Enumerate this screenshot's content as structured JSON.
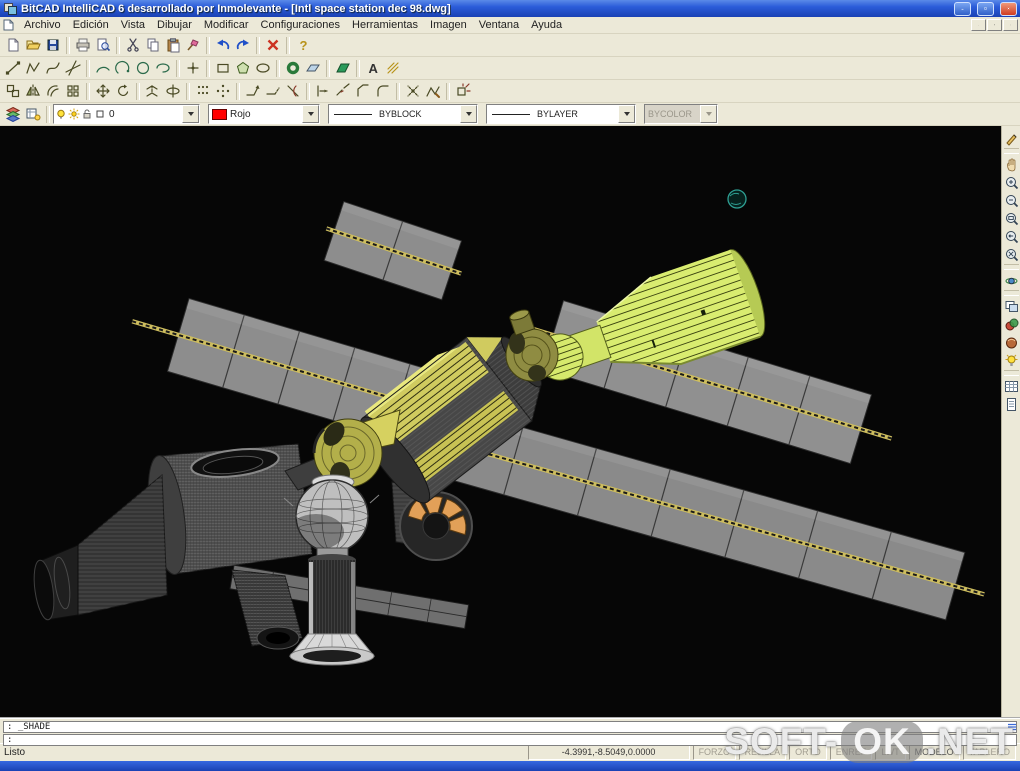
{
  "window": {
    "title": "BitCAD IntelliCAD 6 desarrollado por Inmolevante - [Intl space station dec 98.dwg]",
    "controls": [
      "minimize",
      "maximize",
      "close"
    ]
  },
  "menu": {
    "items": [
      "Archivo",
      "Edición",
      "Vista",
      "Dibujar",
      "Modificar",
      "Configuraciones",
      "Herramientas",
      "Imagen",
      "Ventana",
      "Ayuda"
    ],
    "child_controls": [
      "minimize",
      "restore",
      "close"
    ]
  },
  "toolbars": {
    "standard": [
      "new",
      "open",
      "save",
      "print",
      "print-preview",
      "cut",
      "copy",
      "paste",
      "match-properties",
      "undo",
      "redo",
      "delete",
      "help"
    ],
    "draw": [
      "line",
      "polyline",
      "spline",
      "construction-line",
      "arc",
      "arc-3pt",
      "circle",
      "ellipse-arc",
      "point",
      "rectangle",
      "polygon",
      "ellipse",
      "donut",
      "plane",
      "solid",
      "text",
      "hatch"
    ],
    "modify": [
      "copy",
      "mirror",
      "offset",
      "array",
      "move",
      "rotate",
      "mirror-3d",
      "rotate-3d",
      "array-rect",
      "array-polar",
      "stretch",
      "lengthen",
      "trim",
      "extend",
      "break",
      "chamfer",
      "fillet",
      "explode",
      "edit-polyline",
      "explode-block"
    ],
    "view_vertical": [
      "redraw",
      "pan",
      "zoom-in",
      "zoom-out",
      "zoom-window",
      "zoom-previous",
      "zoom-extents",
      "orbit",
      "named-views",
      "render",
      "materials",
      "lights",
      "table",
      "sheet"
    ],
    "format": {
      "layer_value": "0",
      "color_value": "Rojo",
      "linetype_value": "BYBLOCK",
      "lineweight_value": "BYLAYER",
      "plotstyle_value": "BYCOLOR"
    }
  },
  "icons": {
    "help_glyph": "?",
    "text_glyph": "A"
  },
  "command": {
    "lines": [
      ": _SHADE",
      ":"
    ]
  },
  "status": {
    "ready": "Listo",
    "coords": "-4.3991,-8.5049,0.0000",
    "toggles": [
      "FORZC",
      "REJILLA",
      "ORTO",
      "ENREF",
      "LWT",
      "MODELO",
      "TABLERO"
    ]
  },
  "watermark": {
    "soft": "SOFT-",
    "ok": "OK",
    "net": ".NET"
  },
  "colors": {
    "current_color": "#ff0000",
    "titlebar": "#2b5cd9",
    "viewport_bg": "#060606",
    "model_green": "#d9ec70",
    "solar_gray": "#8d8d8d",
    "truss_yellow": "#cdbd5e"
  }
}
